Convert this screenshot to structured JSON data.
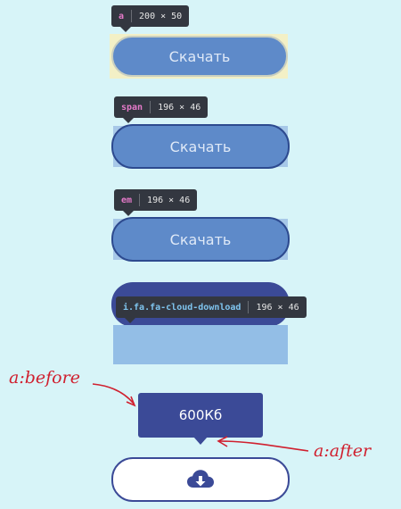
{
  "tooltips": [
    {
      "tag": "a",
      "tag_color": "#e57ac9",
      "size": "200 × 50"
    },
    {
      "tag": "span",
      "tag_color": "#e57ac9",
      "size": "196 × 46"
    },
    {
      "tag": "em",
      "tag_color": "#e57ac9",
      "size": "196 × 46"
    },
    {
      "tag": "i.fa.fa-cloud-download",
      "tag_color": "#7fc4ee",
      "size": "196 × 46"
    }
  ],
  "buttons": [
    {
      "label": "Скачать"
    },
    {
      "label": "Скачать"
    },
    {
      "label": "Скачать"
    }
  ],
  "size_badge": {
    "label": "600Кб"
  },
  "annotations": {
    "before": "a:before",
    "after": "a:after"
  },
  "download_button": {
    "icon": "cloud-download-icon"
  },
  "colors": {
    "background": "#d7f4f8",
    "button_fill": "#5e8ac9",
    "button_border": "#2d4a8f",
    "dark_navy": "#3b4a97",
    "highlight": "#a7c8e8",
    "annotation": "#d0202f"
  }
}
